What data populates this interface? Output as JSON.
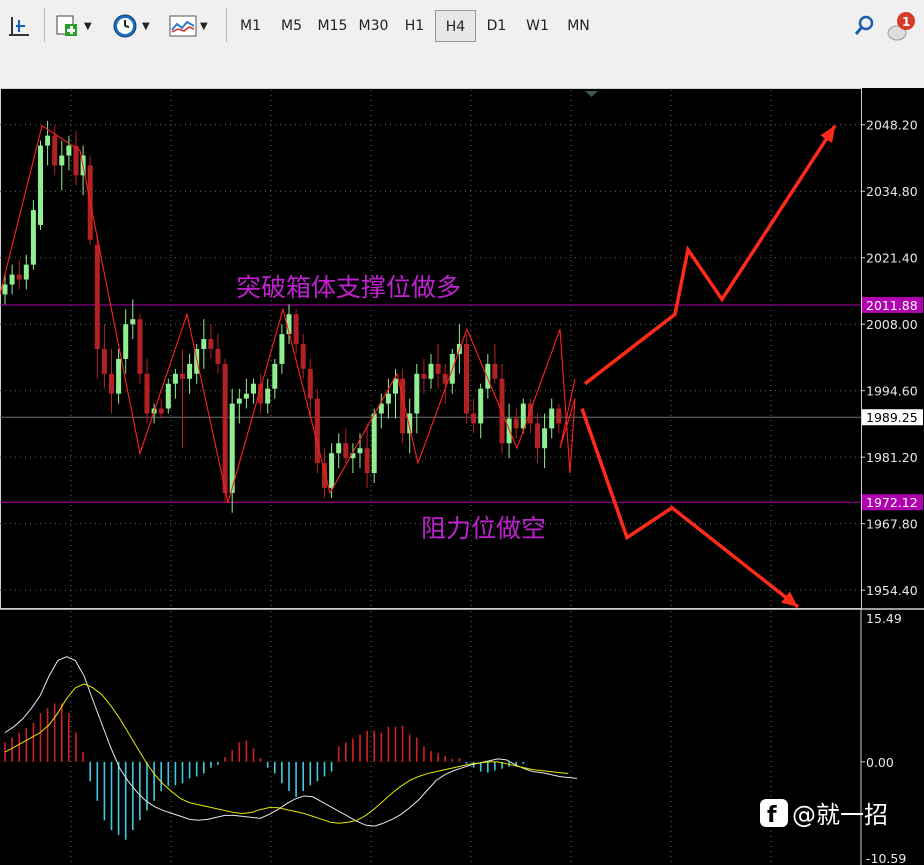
{
  "toolbar": {
    "timeframes": [
      "M1",
      "M5",
      "M15",
      "M30",
      "H1",
      "H4",
      "D1",
      "W1",
      "MN"
    ],
    "active": "H4",
    "notification_count": "1"
  },
  "chart_data": [
    {
      "type": "candlestick",
      "price_axis_ticks": [
        "2048.20",
        "2034.80",
        "2021.40",
        "2008.00",
        "1994.60",
        "1981.20",
        "1967.80",
        "1954.40"
      ],
      "ylim": [
        1950.8,
        2055.2
      ],
      "levels": [
        {
          "price": 2011.88,
          "label": "2011.88",
          "color": "#b000b0"
        },
        {
          "price": 1972.12,
          "label": "1972.12",
          "color": "#b000b0"
        }
      ],
      "current_price": {
        "price": 1989.25,
        "label": "1989.25"
      },
      "annotations": [
        "突破箱体支撑位做多",
        "阻力位做空"
      ],
      "colors": {
        "bull": "#90ee90",
        "bear": "#b22222",
        "zigzag": "#ff2020",
        "arrow": "#ff2a1a"
      },
      "candles": [
        {
          "o": 2014,
          "h": 2018,
          "l": 2012,
          "c": 2016
        },
        {
          "o": 2016,
          "h": 2020,
          "l": 2014,
          "c": 2018
        },
        {
          "o": 2018,
          "h": 2021,
          "l": 2015,
          "c": 2017
        },
        {
          "o": 2017,
          "h": 2022,
          "l": 2015,
          "c": 2020
        },
        {
          "o": 2020,
          "h": 2033,
          "l": 2019,
          "c": 2031
        },
        {
          "o": 2028,
          "h": 2045,
          "l": 2027,
          "c": 2044
        },
        {
          "o": 2044,
          "h": 2049,
          "l": 2040,
          "c": 2046
        },
        {
          "o": 2046,
          "h": 2048,
          "l": 2038,
          "c": 2040
        },
        {
          "o": 2040,
          "h": 2045,
          "l": 2035,
          "c": 2042
        },
        {
          "o": 2042,
          "h": 2046,
          "l": 2039,
          "c": 2044
        },
        {
          "o": 2044,
          "h": 2047,
          "l": 2036,
          "c": 2038
        },
        {
          "o": 2038,
          "h": 2044,
          "l": 2034,
          "c": 2042
        },
        {
          "o": 2040,
          "h": 2042,
          "l": 2024,
          "c": 2025
        },
        {
          "o": 2024,
          "h": 2026,
          "l": 1997,
          "c": 2003
        },
        {
          "o": 2003,
          "h": 2008,
          "l": 1995,
          "c": 1998
        },
        {
          "o": 1998,
          "h": 2003,
          "l": 1990,
          "c": 1994
        },
        {
          "o": 1994,
          "h": 2003,
          "l": 1992,
          "c": 2001
        },
        {
          "o": 2001,
          "h": 2011,
          "l": 1998,
          "c": 2008
        },
        {
          "o": 2008,
          "h": 2013,
          "l": 2005,
          "c": 2009
        },
        {
          "o": 2009,
          "h": 2010,
          "l": 1996,
          "c": 1998
        },
        {
          "o": 1998,
          "h": 2001,
          "l": 1988,
          "c": 1990
        },
        {
          "o": 1990,
          "h": 1992,
          "l": 1988,
          "c": 1991
        },
        {
          "o": 1991,
          "h": 1993,
          "l": 1989,
          "c": 1990
        },
        {
          "o": 1991,
          "h": 1997,
          "l": 1990,
          "c": 1996
        },
        {
          "o": 1996,
          "h": 1999,
          "l": 1993,
          "c": 1998
        },
        {
          "o": 1998,
          "h": 2003,
          "l": 1983,
          "c": 1997
        },
        {
          "o": 1997,
          "h": 2002,
          "l": 1994,
          "c": 2000
        },
        {
          "o": 1998,
          "h": 2004,
          "l": 1996,
          "c": 2003
        },
        {
          "o": 2003,
          "h": 2009,
          "l": 1999,
          "c": 2005
        },
        {
          "o": 2005,
          "h": 2008,
          "l": 2001,
          "c": 2003
        },
        {
          "o": 2003,
          "h": 2006,
          "l": 1998,
          "c": 2000
        },
        {
          "o": 2000,
          "h": 2001,
          "l": 1972,
          "c": 1974
        },
        {
          "o": 1974,
          "h": 1995,
          "l": 1970,
          "c": 1992
        },
        {
          "o": 1992,
          "h": 1995,
          "l": 1988,
          "c": 1993
        },
        {
          "o": 1993,
          "h": 1997,
          "l": 1991,
          "c": 1994
        },
        {
          "o": 1994,
          "h": 1997,
          "l": 1992,
          "c": 1996
        },
        {
          "o": 1996,
          "h": 1998,
          "l": 1990,
          "c": 1992
        },
        {
          "o": 1992,
          "h": 1997,
          "l": 1990,
          "c": 1995
        },
        {
          "o": 1995,
          "h": 2001,
          "l": 1993,
          "c": 2000
        },
        {
          "o": 2000,
          "h": 2008,
          "l": 1998,
          "c": 2006
        },
        {
          "o": 2006,
          "h": 2012,
          "l": 2004,
          "c": 2010
        },
        {
          "o": 2010,
          "h": 2011,
          "l": 2002,
          "c": 2004
        },
        {
          "o": 2004,
          "h": 2006,
          "l": 1997,
          "c": 1999
        },
        {
          "o": 1999,
          "h": 2001,
          "l": 1989,
          "c": 1993
        },
        {
          "o": 1993,
          "h": 1995,
          "l": 1978,
          "c": 1980
        },
        {
          "o": 1980,
          "h": 1983,
          "l": 1973,
          "c": 1975
        },
        {
          "o": 1975,
          "h": 1984,
          "l": 1973,
          "c": 1982
        },
        {
          "o": 1982,
          "h": 1986,
          "l": 1979,
          "c": 1984
        },
        {
          "o": 1984,
          "h": 1987,
          "l": 1980,
          "c": 1981
        },
        {
          "o": 1981,
          "h": 1984,
          "l": 1978,
          "c": 1982
        },
        {
          "o": 1982,
          "h": 1986,
          "l": 1979,
          "c": 1983
        },
        {
          "o": 1983,
          "h": 1988,
          "l": 1975,
          "c": 1978
        },
        {
          "o": 1978,
          "h": 1991,
          "l": 1976,
          "c": 1990
        },
        {
          "o": 1990,
          "h": 1994,
          "l": 1987,
          "c": 1992
        },
        {
          "o": 1992,
          "h": 1997,
          "l": 1989,
          "c": 1994
        },
        {
          "o": 1994,
          "h": 1999,
          "l": 1989,
          "c": 1997
        },
        {
          "o": 1997,
          "h": 1999,
          "l": 1984,
          "c": 1986
        },
        {
          "o": 1986,
          "h": 1993,
          "l": 1982,
          "c": 1990
        },
        {
          "o": 1990,
          "h": 2000,
          "l": 1986,
          "c": 1998
        },
        {
          "o": 1998,
          "h": 2001,
          "l": 1994,
          "c": 1997
        },
        {
          "o": 1997,
          "h": 2002,
          "l": 1995,
          "c": 2000
        },
        {
          "o": 2000,
          "h": 2004,
          "l": 1995,
          "c": 1998
        },
        {
          "o": 1998,
          "h": 2000,
          "l": 1992,
          "c": 1996
        },
        {
          "o": 1996,
          "h": 2003,
          "l": 1994,
          "c": 2002
        },
        {
          "o": 2002,
          "h": 2008,
          "l": 1998,
          "c": 2004
        },
        {
          "o": 2004,
          "h": 2006,
          "l": 1988,
          "c": 1990
        },
        {
          "o": 1990,
          "h": 1993,
          "l": 1986,
          "c": 1988
        },
        {
          "o": 1988,
          "h": 1996,
          "l": 1985,
          "c": 1995
        },
        {
          "o": 1995,
          "h": 2002,
          "l": 1993,
          "c": 2000
        },
        {
          "o": 2000,
          "h": 2004,
          "l": 1996,
          "c": 1997
        },
        {
          "o": 1997,
          "h": 2000,
          "l": 1982,
          "c": 1984
        },
        {
          "o": 1984,
          "h": 1992,
          "l": 1981,
          "c": 1989
        },
        {
          "o": 1989,
          "h": 1991,
          "l": 1985,
          "c": 1987
        },
        {
          "o": 1987,
          "h": 1993,
          "l": 1986,
          "c": 1992
        },
        {
          "o": 1992,
          "h": 1993,
          "l": 1986,
          "c": 1988
        },
        {
          "o": 1988,
          "h": 1990,
          "l": 1980,
          "c": 1983
        },
        {
          "o": 1983,
          "h": 1990,
          "l": 1979,
          "c": 1987
        },
        {
          "o": 1987,
          "h": 1993,
          "l": 1985,
          "c": 1991
        },
        {
          "o": 1991,
          "h": 1992,
          "l": 1986,
          "c": 1988
        }
      ],
      "zigzag_prices": [
        2014,
        2048,
        2043,
        1982,
        2010,
        1972,
        2011,
        1974,
        1998,
        1980,
        2007,
        1983,
        2007,
        1978,
        1993,
        1983,
        1997
      ],
      "forecast_up_prices": [
        1996,
        2010,
        2023,
        2013,
        2048
      ],
      "forecast_down_prices": [
        1991,
        1965,
        1971,
        1951
      ]
    },
    {
      "type": "macd",
      "axis_ticks": [
        "15.49",
        "0.00",
        "-10.59"
      ],
      "ylim": [
        -10.59,
        15.49
      ],
      "colors": {
        "pos": "#d02020",
        "neg": "#40c8e0",
        "main": "#e8e8e8",
        "signal": "#e8e800"
      },
      "histogram": [
        2,
        2.5,
        3,
        3.5,
        4,
        5,
        5.5,
        6,
        6,
        5,
        3,
        1,
        -2,
        -4,
        -6,
        -7,
        -7.5,
        -8,
        -7,
        -6,
        -5,
        -4,
        -3,
        -2.5,
        -2.4,
        -2.2,
        -1.7,
        -1.5,
        -1.2,
        -0.6,
        -0.3,
        0.5,
        1.2,
        2.0,
        2.2,
        1.4,
        0.4,
        -0.6,
        -1.2,
        -2.2,
        -3.0,
        -3.6,
        -3.0,
        -2.4,
        -2.0,
        -1.5,
        -1.0,
        1.6,
        2.0,
        2.4,
        2.8,
        3.2,
        3.2,
        3.0,
        3.6,
        3.6,
        3.7,
        2.8,
        2.5,
        1.6,
        1.1,
        0.9,
        0.6,
        0.3,
        0.4,
        -0.2,
        -0.6,
        -1,
        -1.1,
        -0.9,
        -0.7,
        -0.5,
        -0.3,
        -0.2
      ],
      "main_line": [
        3,
        3.6,
        4.4,
        5.5,
        6.8,
        8.8,
        10.4,
        10.8,
        10.4,
        8.8,
        6.3,
        3.9,
        1.5,
        -0.6,
        -2.0,
        -3.1,
        -4.0,
        -4.6,
        -5.0,
        -5.3,
        -5.6,
        -5.9,
        -6.0,
        -5.9,
        -5.7,
        -5.5,
        -5.5,
        -5.6,
        -5.7,
        -5.8,
        -5.4,
        -4.9,
        -4.3,
        -3.8,
        -3.5,
        -3.6,
        -4.1,
        -4.6,
        -5.1,
        -5.6,
        -6.1,
        -6.5,
        -6.6,
        -6.3,
        -5.9,
        -5.4,
        -4.7,
        -3.9,
        -2.9,
        -1.9,
        -1.3,
        -0.9,
        -0.6,
        -0.3,
        -0.1,
        0.1,
        0.3,
        0.2,
        -0.3,
        -0.7,
        -1.0,
        -1.1,
        -1.3,
        -1.5,
        -1.6,
        -1.7
      ],
      "signal_line": [
        1.0,
        1.5,
        2.0,
        2.5,
        3.0,
        3.8,
        5.0,
        6.5,
        7.6,
        8.0,
        7.6,
        6.9,
        5.8,
        4.5,
        3.0,
        1.5,
        0.0,
        -1.3,
        -2.3,
        -3.1,
        -3.8,
        -4.2,
        -4.4,
        -4.6,
        -4.8,
        -5.0,
        -5.2,
        -5.3,
        -5.2,
        -4.9,
        -4.7,
        -4.7,
        -4.9,
        -5.1,
        -5.3,
        -5.6,
        -5.9,
        -6.2,
        -6.3,
        -6.2,
        -6.0,
        -5.5,
        -4.8,
        -4.0,
        -3.2,
        -2.5,
        -1.9,
        -1.5,
        -1.2,
        -1.0,
        -0.8,
        -0.6,
        -0.4,
        -0.2,
        -0.1,
        0.0,
        0.0,
        -0.2,
        -0.4,
        -0.6,
        -0.8,
        -0.9,
        -1.0,
        -1.1,
        -1.2
      ]
    }
  ],
  "watermark": {
    "text": "@就一招"
  }
}
